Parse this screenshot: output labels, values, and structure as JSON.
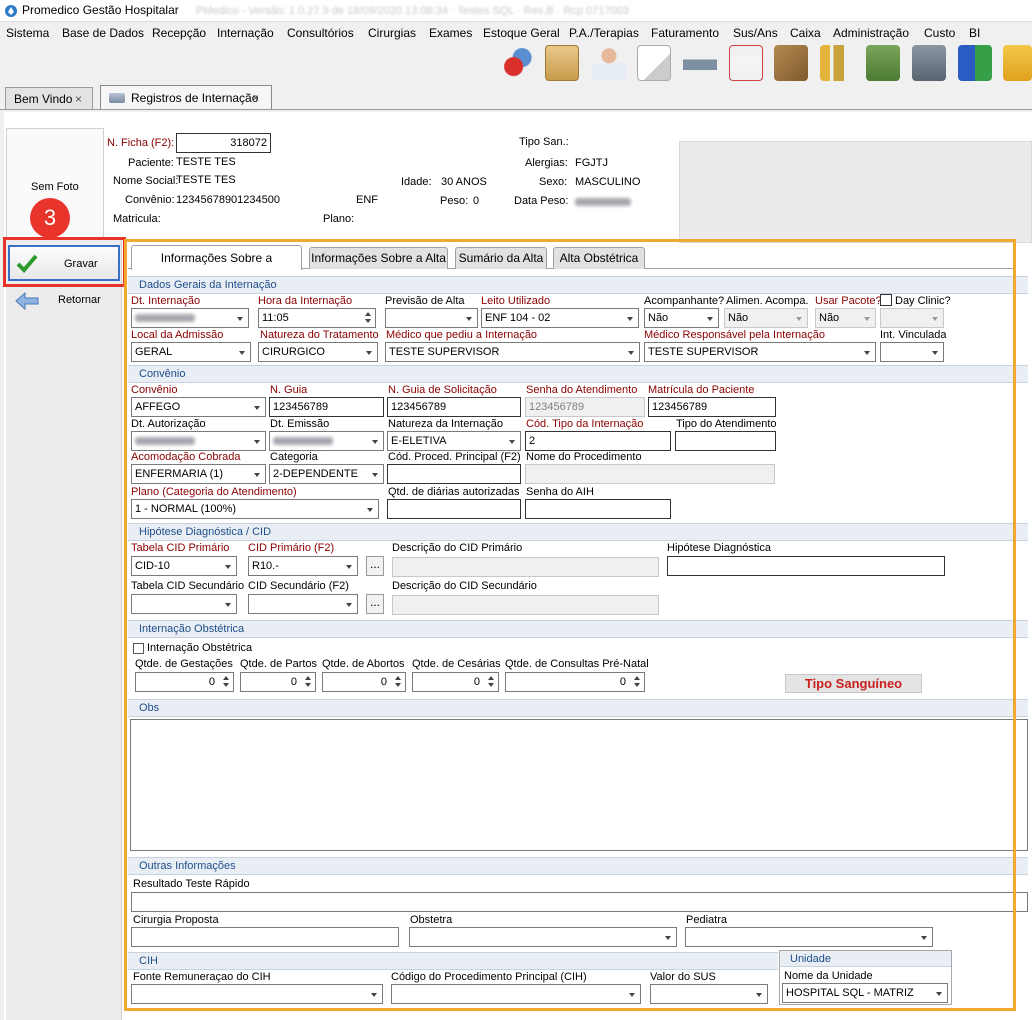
{
  "window": {
    "title": "Promedico Gestão Hospitalar",
    "subtitle": "PMedico - Versão: 1.0.27.9 de 18/09/2020 13:08:34 · Testes SQL · Res.B · Rcp 0717003"
  },
  "menu": [
    "Sistema",
    "Base de Dados",
    "Recepção",
    "Internação",
    "Consultórios",
    "Cirurgias",
    "Exames",
    "Estoque Geral",
    "P.A./Terapias",
    "Faturamento",
    "Sus/Ans",
    "Caixa",
    "Administração",
    "Custo",
    "BI"
  ],
  "tabs": [
    {
      "label": "Bem Vindo",
      "close": "×"
    },
    {
      "label": "Registros de Internação",
      "close": "×"
    }
  ],
  "left_panel": {
    "photo_label": "Sem Foto",
    "step_badge": "3",
    "save_label": "Gravar",
    "back_label": "Retornar"
  },
  "header": {
    "ficha_label": "N. Ficha (F2):",
    "ficha_value": "318072",
    "paciente_label": "Paciente:",
    "paciente_value": "TESTE TES",
    "nome_social_label": "Nome Social:",
    "nome_social_value": "TESTE TES",
    "convenio_label": "Convênio:",
    "convenio_value": "12345678901234500",
    "convenio_tipo": "ENF",
    "matricula_label": "Matricula:",
    "plano_label": "Plano:",
    "idade_label": "Idade:",
    "idade_value": "30 ANOS",
    "peso_label": "Peso:",
    "peso_value": "0",
    "tipo_san_label": "Tipo San.:",
    "alergias_label": "Alergias:",
    "alergias_value": "FGJTJ",
    "sexo_label": "Sexo:",
    "sexo_value": "MASCULINO",
    "data_peso_label": "Data Peso:"
  },
  "inner_tabs": [
    "Informações Sobre a Internação",
    "Informações Sobre a Alta",
    "Sumário da Alta",
    "Alta Obstétrica"
  ],
  "sections": {
    "dados_gerais": "Dados Gerais da Internação",
    "convenio": "Convênio",
    "hipotese": "Hipótese Diagnóstica / CID",
    "obstetrica": "Internação Obstétrica",
    "obs": "Obs",
    "outras": "Outras Informações",
    "cih": "CIH",
    "unidade": "Unidade"
  },
  "dados_gerais": {
    "dt_internacao": "Dt. Internação",
    "hora_internacao": "Hora da Internação",
    "hora_value": "11:05",
    "previsao_alta": "Previsão de Alta",
    "leito": "Leito Utilizado",
    "leito_value": "ENF 104 - 02",
    "acompanhante": "Acompanhante?",
    "acompanhante_value": "Não",
    "alimen": "Alimen. Acompa.",
    "alimen_value": "Não",
    "usar_pacote": "Usar Pacote?",
    "usar_pacote_value": "Não",
    "day_clinic": "Day Clinic?",
    "local_admissao": "Local da Admissão",
    "local_value": "GERAL",
    "natureza": "Natureza do Tratamento",
    "natureza_value": "CIRURGICO",
    "medico_pediu": "Médico que pediu a Internação",
    "medico_pediu_value": "TESTE SUPERVISOR",
    "medico_resp": "Médico Responsável pela Internação",
    "medico_resp_value": "TESTE SUPERVISOR",
    "int_vinculada": "Int. Vinculada"
  },
  "convenio": {
    "convenio": "Convênio",
    "convenio_value": "AFFEGO",
    "guia": "N. Guia",
    "guia_value": "123456789",
    "guia_solic": "N. Guia de Solicitação",
    "guia_solic_value": "123456789",
    "senha": "Senha do Atendimento",
    "senha_value": "123456789",
    "matricula": "Matrícula do Paciente",
    "matricula_value": "123456789",
    "dt_autorizacao": "Dt. Autorização",
    "dt_emissao": "Dt. Emissão",
    "natureza_int": "Natureza da Internação",
    "natureza_int_value": "E-ELETIVA",
    "cod_tipo": "Cód. Tipo da Internação",
    "cod_tipo_value": "2",
    "tipo_atend": "Tipo do Atendimento",
    "acomodacao": "Acomodação Cobrada",
    "acomodacao_value": "ENFERMARIA (1)",
    "categoria": "Categoria",
    "categoria_value": "2-DEPENDENTE",
    "cod_proced": "Cód. Proced. Principal (F2)",
    "nome_proced": "Nome do Procedimento",
    "plano": "Plano (Categoria do Atendimento)",
    "plano_value": "1 - NORMAL (100%)",
    "qtd_diarias": "Qtd. de diárias autorizadas",
    "senha_aih": "Senha do AIH"
  },
  "cid": {
    "tabela_primario": "Tabela CID Primário",
    "tabela_primario_value": "CID-10",
    "cid_primario": "CID Primário (F2)",
    "cid_primario_value": "R10.-",
    "desc_primario": "Descrição do CID Primário",
    "hipotese": "Hipótese Diagnóstica",
    "tabela_secundario": "Tabela CID Secundário",
    "cid_secundario": "CID Secundário (F2)",
    "desc_secundario": "Descrição do CID Secundário",
    "lookup": "..."
  },
  "obstetrica": {
    "checkbox": "Internação Obstétrica",
    "gestacoes": "Qtde. de Gestações",
    "partos": "Qtde. de Partos",
    "abortos": "Qtde. de Abortos",
    "cesarias": "Qtde. de Cesárias",
    "consultas": "Qtde. de Consultas Pré-Natal",
    "zero": "0",
    "tipo_sanguineo": "Tipo Sanguíneo"
  },
  "outras": {
    "resultado": "Resultado Teste Rápido",
    "cirurgia": "Cirurgia Proposta",
    "obstetra": "Obstetra",
    "pediatra": "Pediatra"
  },
  "cih": {
    "fonte": "Fonte Remuneraçao do CIH",
    "codigo": "Código do Procedimento Principal (CIH)",
    "valor": "Valor do SUS"
  },
  "unidade": {
    "nome_label": "Nome da Unidade",
    "nome_value": "HOSPITAL SQL - MATRIZ"
  },
  "colors": {
    "accent_orange": "#f0a830",
    "highlight_red": "#e8342a",
    "label_red": "#8b0000",
    "section_blue": "#1f4e8c"
  }
}
